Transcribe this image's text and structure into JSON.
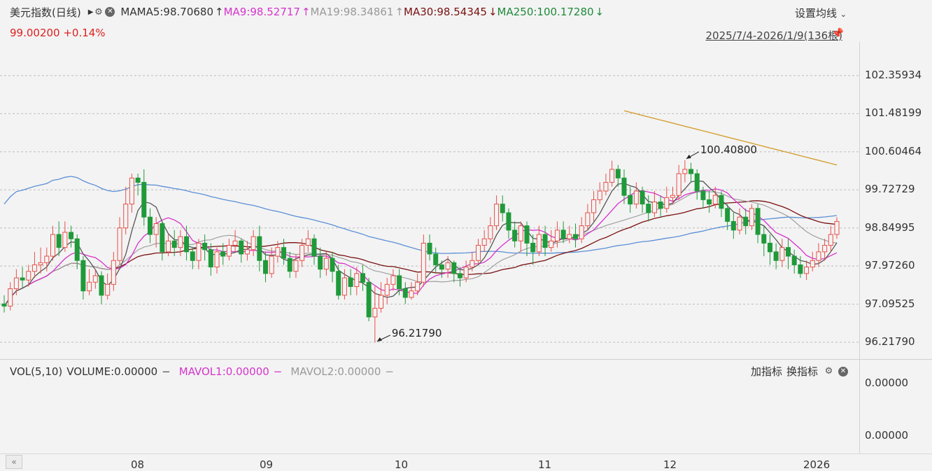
{
  "header": {
    "title": "美元指数(日线)",
    "ma_label": "MA",
    "ma5": "MA5:98.70680",
    "ma5_arrow": "↑",
    "ma9": "MA9:98.52717",
    "ma9_arrow": "↑",
    "ma19": "MA19:98.34861",
    "ma19_arrow": "↑",
    "ma30": "MA30:98.54345",
    "ma30_arrow": "↓",
    "ma250": "MA250:100.17280",
    "ma250_arrow": "↓",
    "price_change": "99.00200 +0.14%",
    "settings": "设置均线",
    "range": "2025/7/4-2026/1/9(136根)"
  },
  "volume": {
    "title": "VOL(5,10)",
    "volume": "VOLUME:0.00000",
    "mavol1": "MAVOL1:0.00000",
    "mavol2": "MAVOL2:0.00000",
    "add_indicator": "加指标",
    "switch_indicator": "换指标",
    "ytick_top": "0.00000",
    "ytick_bottom": "0.00000"
  },
  "colors": {
    "up": "#e8504a",
    "down": "#1f9a3a",
    "ma5": "#555555",
    "ma9": "#d633cc",
    "ma19": "#a0a0a0",
    "ma30": "#7a1010",
    "ma250": "#d4a030",
    "blue": "#5b8fd6"
  },
  "chart_data": {
    "type": "candlestick",
    "yticks": [
      "102.35934",
      "101.48199",
      "100.60464",
      "99.72729",
      "98.84995",
      "97.97260",
      "97.09525",
      "96.21790"
    ],
    "ylim": [
      96.2179,
      102.35934
    ],
    "xticks": [
      "08",
      "09",
      "10",
      "11",
      "12",
      "2026"
    ],
    "annotations": {
      "high": "100.40800",
      "low": "96.21790"
    },
    "count": 136,
    "candles": [
      [
        97.1,
        97.05,
        97.3,
        96.9
      ],
      [
        97.05,
        97.45,
        97.6,
        96.95
      ],
      [
        97.45,
        97.7,
        97.9,
        97.3
      ],
      [
        97.7,
        97.65,
        97.95,
        97.45
      ],
      [
        97.65,
        97.85,
        98.0,
        97.5
      ],
      [
        97.85,
        98.0,
        98.3,
        97.7
      ],
      [
        98.0,
        98.05,
        98.4,
        97.8
      ],
      [
        98.05,
        98.2,
        98.4,
        97.85
      ],
      [
        98.2,
        98.7,
        98.9,
        98.1
      ],
      [
        98.7,
        98.4,
        99.0,
        98.2
      ],
      [
        98.4,
        98.75,
        99.0,
        98.3
      ],
      [
        98.75,
        98.6,
        98.9,
        98.4
      ],
      [
        98.6,
        98.1,
        98.7,
        97.9
      ],
      [
        98.1,
        97.4,
        98.2,
        97.2
      ],
      [
        97.4,
        97.6,
        97.9,
        97.3
      ],
      [
        97.6,
        97.75,
        97.9,
        97.45
      ],
      [
        97.75,
        97.3,
        97.85,
        97.1
      ],
      [
        97.3,
        97.55,
        97.8,
        97.2
      ],
      [
        97.55,
        98.1,
        98.3,
        97.4
      ],
      [
        98.1,
        98.85,
        99.1,
        98.0
      ],
      [
        98.85,
        99.4,
        99.8,
        98.7
      ],
      [
        99.4,
        100.0,
        100.1,
        99.2
      ],
      [
        100.0,
        99.9,
        100.1,
        99.6
      ],
      [
        99.9,
        99.1,
        100.2,
        98.9
      ],
      [
        99.1,
        98.7,
        99.3,
        98.5
      ],
      [
        98.7,
        98.95,
        99.1,
        98.4
      ],
      [
        98.95,
        98.3,
        99.0,
        98.1
      ],
      [
        98.3,
        98.55,
        98.7,
        98.2
      ],
      [
        98.55,
        98.4,
        98.8,
        98.2
      ],
      [
        98.4,
        98.65,
        98.8,
        98.2
      ],
      [
        98.65,
        98.3,
        98.9,
        98.1
      ],
      [
        98.3,
        98.1,
        98.4,
        97.9
      ],
      [
        98.1,
        98.5,
        98.6,
        97.9
      ],
      [
        98.5,
        98.35,
        98.7,
        98.1
      ],
      [
        98.35,
        97.95,
        98.5,
        97.75
      ],
      [
        97.95,
        98.3,
        98.4,
        97.8
      ],
      [
        98.3,
        98.2,
        98.5,
        98.0
      ],
      [
        98.2,
        98.45,
        98.6,
        98.1
      ],
      [
        98.45,
        98.55,
        98.8,
        98.3
      ],
      [
        98.55,
        98.25,
        98.6,
        98.05
      ],
      [
        98.25,
        98.35,
        98.55,
        98.1
      ],
      [
        98.35,
        98.65,
        98.8,
        98.2
      ],
      [
        98.65,
        98.1,
        98.9,
        97.85
      ],
      [
        98.1,
        97.8,
        98.3,
        97.6
      ],
      [
        97.8,
        98.2,
        98.4,
        97.7
      ],
      [
        98.2,
        98.4,
        98.55,
        98.05
      ],
      [
        98.4,
        98.15,
        98.6,
        98.0
      ],
      [
        98.15,
        97.85,
        98.3,
        97.7
      ],
      [
        97.85,
        98.1,
        98.25,
        97.7
      ],
      [
        98.1,
        98.45,
        98.6,
        97.95
      ],
      [
        98.45,
        98.6,
        98.8,
        98.3
      ],
      [
        98.6,
        98.2,
        98.7,
        98.0
      ],
      [
        98.2,
        97.9,
        98.4,
        97.7
      ],
      [
        97.9,
        98.15,
        98.3,
        97.75
      ],
      [
        98.15,
        97.85,
        98.3,
        97.6
      ],
      [
        97.85,
        97.3,
        98.0,
        97.2
      ],
      [
        97.3,
        97.7,
        97.9,
        97.2
      ],
      [
        97.7,
        97.5,
        97.9,
        97.3
      ],
      [
        97.5,
        97.8,
        97.95,
        97.3
      ],
      [
        97.8,
        97.6,
        98.0,
        97.4
      ],
      [
        97.6,
        96.8,
        97.7,
        96.7
      ],
      [
        96.8,
        97.0,
        97.5,
        96.22
      ],
      [
        97.0,
        97.3,
        97.6,
        96.9
      ],
      [
        97.3,
        97.55,
        97.7,
        97.1
      ],
      [
        97.55,
        97.75,
        97.9,
        97.4
      ],
      [
        97.75,
        97.45,
        97.9,
        97.3
      ],
      [
        97.45,
        97.25,
        97.6,
        97.1
      ],
      [
        97.25,
        97.4,
        97.6,
        97.2
      ],
      [
        97.4,
        97.6,
        97.8,
        97.3
      ],
      [
        97.6,
        98.5,
        98.7,
        97.5
      ],
      [
        98.5,
        98.25,
        98.7,
        98.1
      ],
      [
        98.25,
        98.0,
        98.4,
        97.8
      ]
    ],
    "candles_right": [
      [
        98.0,
        97.9,
        98.1,
        97.7
      ],
      [
        97.9,
        98.05,
        98.2,
        97.7
      ],
      [
        98.05,
        97.8,
        98.1,
        97.6
      ],
      [
        97.8,
        97.7,
        97.95,
        97.5
      ],
      [
        97.7,
        97.95,
        98.1,
        97.6
      ],
      [
        97.95,
        98.1,
        98.3,
        97.85
      ],
      [
        98.1,
        98.45,
        98.6,
        98.0
      ],
      [
        98.45,
        98.6,
        98.8,
        98.3
      ],
      [
        98.6,
        98.9,
        99.1,
        98.5
      ],
      [
        98.9,
        99.4,
        99.6,
        98.8
      ],
      [
        99.4,
        99.2,
        99.6,
        99.0
      ],
      [
        99.2,
        98.8,
        99.3,
        98.6
      ],
      [
        98.8,
        98.55,
        99.0,
        98.4
      ],
      [
        98.55,
        98.9,
        99.0,
        98.3
      ],
      [
        98.9,
        98.5,
        99.0,
        98.2
      ],
      [
        98.5,
        98.3,
        98.7,
        98.0
      ],
      [
        98.3,
        98.7,
        98.9,
        98.2
      ],
      [
        98.7,
        98.4,
        98.9,
        98.2
      ],
      [
        98.4,
        98.55,
        98.8,
        98.3
      ],
      [
        98.55,
        98.8,
        99.0,
        98.4
      ],
      [
        98.8,
        98.6,
        99.0,
        98.5
      ],
      [
        98.6,
        98.7,
        98.9,
        98.5
      ],
      [
        98.7,
        98.6,
        98.95,
        98.4
      ],
      [
        98.6,
        98.9,
        99.1,
        98.5
      ],
      [
        98.9,
        99.2,
        99.4,
        98.8
      ],
      [
        99.2,
        99.5,
        99.7,
        99.0
      ],
      [
        99.5,
        99.7,
        99.9,
        99.4
      ],
      [
        99.7,
        99.9,
        100.1,
        99.6
      ],
      [
        99.9,
        100.2,
        100.4,
        99.8
      ],
      [
        100.2,
        100.0,
        100.3,
        99.8
      ],
      [
        100.0,
        99.6,
        100.2,
        99.4
      ],
      [
        99.6,
        99.4,
        99.8,
        99.2
      ],
      [
        99.4,
        99.7,
        99.9,
        99.3
      ],
      [
        99.7,
        99.4,
        99.8,
        99.2
      ],
      [
        99.4,
        99.2,
        99.6,
        99.0
      ],
      [
        99.2,
        99.45,
        99.7,
        99.1
      ],
      [
        99.45,
        99.3,
        99.6,
        99.1
      ],
      [
        99.3,
        99.55,
        99.8,
        99.2
      ],
      [
        99.55,
        99.6,
        99.8,
        99.4
      ],
      [
        99.6,
        100.1,
        100.3,
        99.5
      ],
      [
        100.1,
        100.2,
        100.41,
        99.9
      ],
      [
        100.2,
        100.1,
        100.35,
        99.9
      ],
      [
        100.1,
        99.7,
        100.2,
        99.5
      ],
      [
        99.7,
        99.5,
        99.8,
        99.3
      ],
      [
        99.5,
        99.4,
        99.7,
        99.2
      ],
      [
        99.4,
        99.6,
        99.8,
        99.3
      ],
      [
        99.6,
        99.3,
        99.7,
        99.1
      ],
      [
        99.3,
        99.0,
        99.4,
        98.8
      ],
      [
        99.0,
        98.8,
        99.2,
        98.6
      ],
      [
        98.8,
        99.1,
        99.3,
        98.7
      ],
      [
        99.1,
        98.9,
        99.3,
        98.7
      ],
      [
        98.9,
        99.3,
        99.4,
        98.8
      ],
      [
        99.3,
        98.7,
        99.4,
        98.5
      ],
      [
        98.7,
        98.5,
        98.9,
        98.2
      ],
      [
        98.5,
        98.3,
        98.7,
        98.0
      ],
      [
        98.3,
        98.1,
        98.5,
        97.9
      ],
      [
        98.1,
        98.4,
        98.6,
        97.95
      ],
      [
        98.4,
        98.2,
        98.6,
        97.9
      ],
      [
        98.2,
        98.0,
        98.35,
        97.8
      ],
      [
        98.0,
        97.8,
        98.2,
        97.7
      ],
      [
        97.8,
        97.95,
        98.1,
        97.65
      ],
      [
        97.95,
        98.1,
        98.3,
        97.85
      ],
      [
        98.1,
        98.3,
        98.5,
        97.95
      ],
      [
        98.3,
        98.45,
        98.6,
        98.1
      ],
      [
        98.45,
        98.7,
        98.9,
        98.3
      ],
      [
        98.7,
        99.0,
        99.1,
        98.6
      ]
    ]
  }
}
